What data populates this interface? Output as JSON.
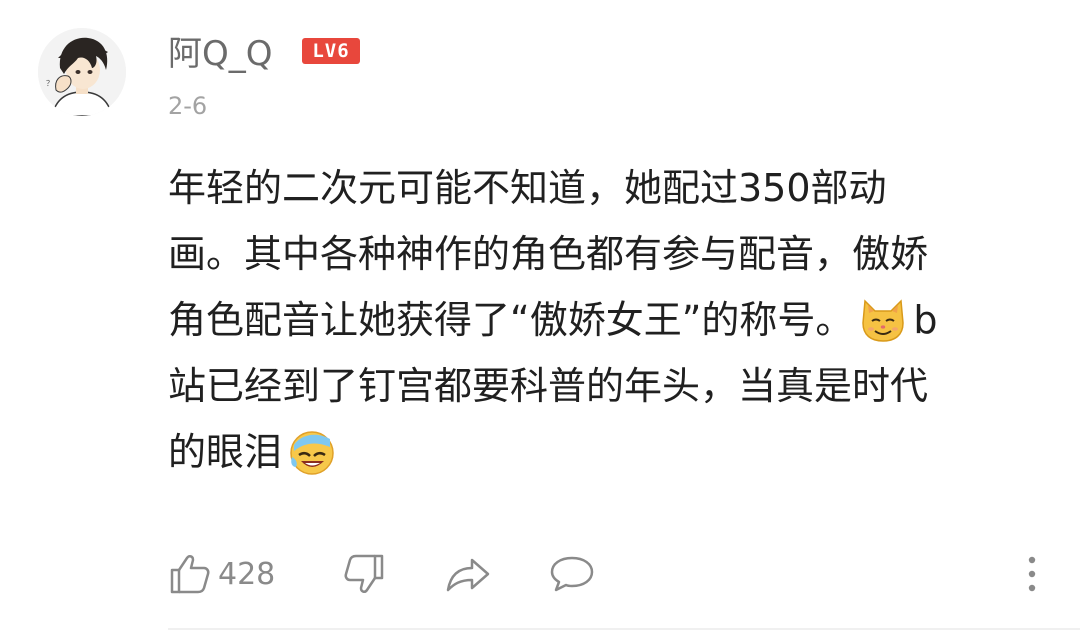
{
  "comment": {
    "username": "阿Q_Q",
    "level_badge": "LV6",
    "date": "2-6",
    "content_lines": [
      "年轻的二次元可能不知道，她配过350部动",
      "画。其中各种神作的角色都有参与配音，傲娇",
      "角色配音让她获得了“傲娇女王”的称号。",
      "站已经到了钉宫都要科普的年头，当真是时代",
      "的眼泪"
    ],
    "line3_after_emoji": "b",
    "emoji_1": "smug-cat-emoji",
    "emoji_2": "laugh-cry-emoji",
    "like_count": "428",
    "icons": {
      "like": "thumbs-up-icon",
      "dislike": "thumbs-down-icon",
      "share": "share-arrow-icon",
      "reply": "comment-bubble-icon",
      "more": "more-vertical-icon"
    },
    "colors": {
      "badge": "#e8473c",
      "text": "#202020",
      "meta": "#a3a3a3",
      "icon": "#8a8a8a"
    }
  }
}
